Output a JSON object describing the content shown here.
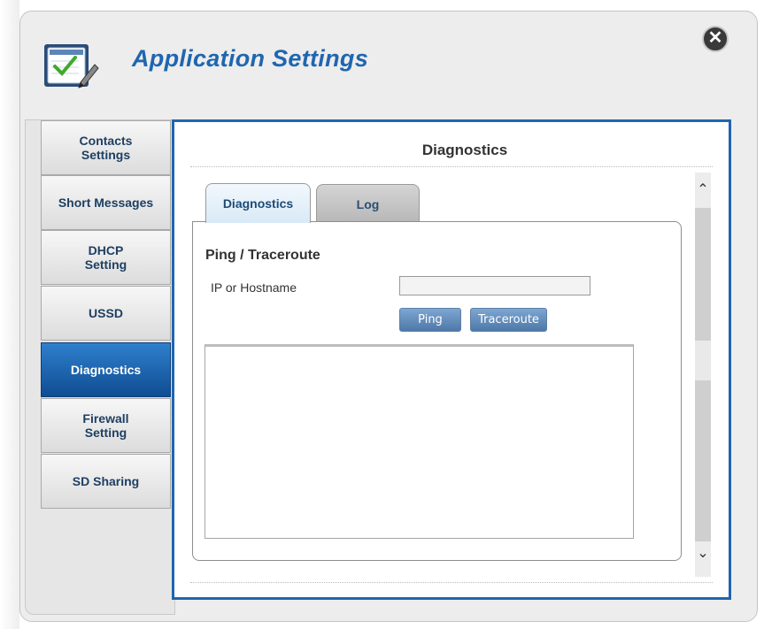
{
  "app": {
    "title": "Application Settings",
    "icon": "checklist-pencil-icon",
    "close_icon": "close-icon"
  },
  "sidebar": {
    "items": [
      {
        "label": "Contacts\nSettings",
        "active": false
      },
      {
        "label": "Short Messages",
        "active": false
      },
      {
        "label": "DHCP\nSetting",
        "active": false
      },
      {
        "label": "USSD",
        "active": false
      },
      {
        "label": "Diagnostics",
        "active": true
      },
      {
        "label": "Firewall\nSetting",
        "active": false
      },
      {
        "label": "SD Sharing",
        "active": false
      }
    ]
  },
  "panel": {
    "title": "Diagnostics",
    "tabs": [
      {
        "label": "Diagnostics",
        "active": true
      },
      {
        "label": "Log",
        "active": false
      }
    ],
    "ping": {
      "section_title": "Ping / Traceroute",
      "ip_label": "IP or Hostname",
      "ip_value": "",
      "ping_button": "Ping",
      "traceroute_button": "Traceroute",
      "output_text": ""
    },
    "scrollbar": {
      "up_icon": "chevron-up-icon",
      "down_icon": "chevron-down-icon"
    }
  },
  "colors": {
    "accent": "#1f66b0",
    "active_nav": "#0f4d92",
    "button": "#4d78a8"
  }
}
